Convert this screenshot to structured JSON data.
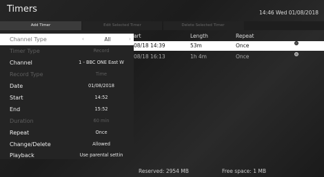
{
  "header": {
    "title": "Timers",
    "clock": "14:46 Wed 01/08/2018"
  },
  "buttons": {
    "add": "Add Timer",
    "edit": "Edit Selected Timer",
    "delete": "Delete Selected Timer"
  },
  "timers": {
    "columns": {
      "start": "art",
      "length": "Length",
      "repeat": "Repeat"
    },
    "rows": [
      {
        "start": "08/18  14:39",
        "length": "53m",
        "repeat": "Once",
        "icon": "record-dot-icon"
      },
      {
        "start": "08/18  16:13",
        "length": "1h 4m",
        "repeat": "Once",
        "icon": "record-dot-icon"
      }
    ]
  },
  "settings": {
    "rows": [
      {
        "label": "Channel Type",
        "value": "All"
      },
      {
        "label": "Timer Type",
        "value": "Record"
      },
      {
        "label": "Channel",
        "value": "1 - BBC ONE East W"
      },
      {
        "label": "Record Type",
        "value": "Time"
      },
      {
        "label": "Date",
        "value": "01/08/2018"
      },
      {
        "label": "Start",
        "value": "14:52"
      },
      {
        "label": "End",
        "value": "15:52"
      },
      {
        "label": "Duration",
        "value": "60 min"
      },
      {
        "label": "Repeat",
        "value": "Once"
      },
      {
        "label": "Change/Delete",
        "value": "Allowed"
      },
      {
        "label": "Playback",
        "value": "Use parental settin"
      }
    ],
    "arrows": {
      "left": "‹",
      "right": "›"
    }
  },
  "footer": {
    "reserved": "Reserved: 2954 MB",
    "free": "Free space: 1 MB"
  }
}
